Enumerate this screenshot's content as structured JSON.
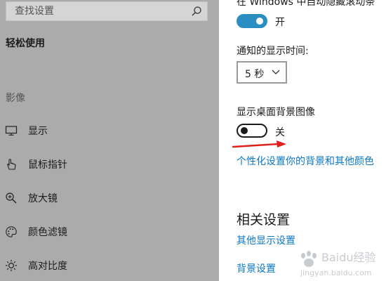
{
  "search": {
    "placeholder": "查找设置",
    "icon": "search-icon"
  },
  "sidebar": {
    "title": "轻松使用",
    "group_label": "影像",
    "items": [
      {
        "label": "显示",
        "icon": "monitor-icon"
      },
      {
        "label": "鼠标指针",
        "icon": "pointer-hand-icon"
      },
      {
        "label": "放大镜",
        "icon": "magnifier-zoom-icon"
      },
      {
        "label": "颜色滤镜",
        "icon": "palette-icon"
      },
      {
        "label": "高对比度",
        "icon": "sun-contrast-icon"
      }
    ]
  },
  "main": {
    "clipped_setting_text": "在 Windows 中自动隐藏滚动条",
    "scrollbar_toggle_state": "开",
    "notify_label": "通知的显示时间:",
    "notify_value": "5 秒",
    "background_label": "显示桌面背景图像",
    "background_toggle_state": "关",
    "personalize_link": "个性化设置你的背景和其他颜色",
    "related_title": "相关设置",
    "other_display_link": "其他显示设置",
    "background_settings_link": "背景设置"
  },
  "watermark": {
    "brand": "Baidu经验",
    "url": "jingyan.baidu.com"
  },
  "colors": {
    "sidebar_bg": "#ababab",
    "accent": "#2a8ec2",
    "link": "#0b77c4",
    "arrow": "#e0201c"
  }
}
